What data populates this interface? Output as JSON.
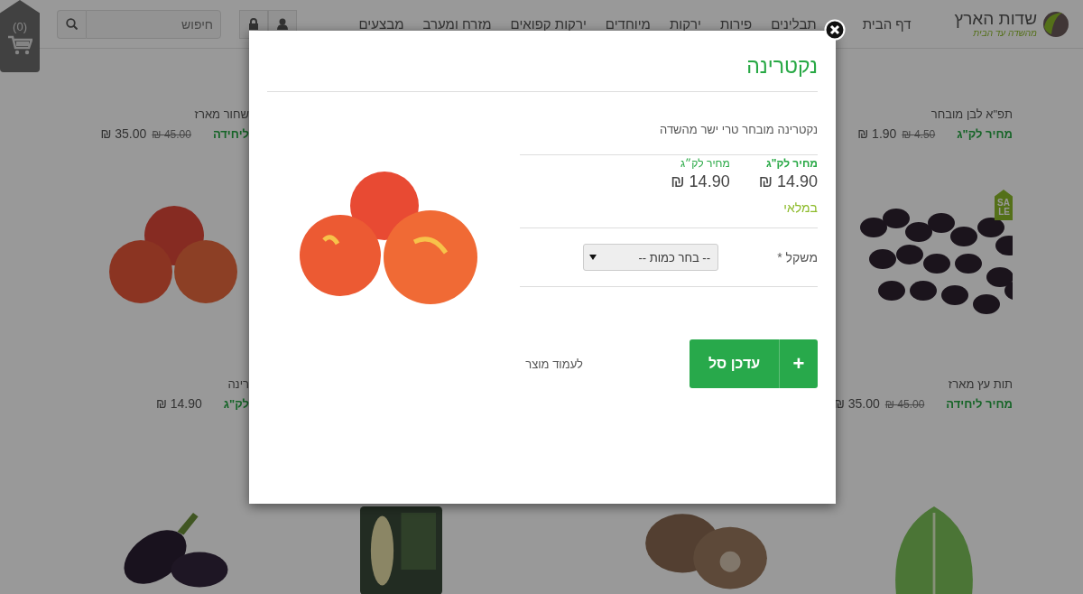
{
  "header": {
    "logo": {
      "name": "שדות הארץ",
      "tagline": "מהשדה עד הבית"
    },
    "nav": [
      "דף הבית",
      "תבלינים",
      "פירות",
      "ירקות",
      "מיוחדים",
      "ירקות קפואים",
      "מזרח ומערב",
      "מבצעים"
    ],
    "search": {
      "placeholder": "חיפוש"
    },
    "cart": {
      "count": "(0)"
    }
  },
  "products": [
    {
      "cards": [
        {
          "name": "תפ\"א לבן מובחר",
          "price_label": "מחיר לק\"ג",
          "old_price": "4.50 ₪",
          "price": "1.90 ₪"
        },
        {
          "name": "שחור מארז",
          "price_label": "ליחידה",
          "old_price": "45.00 ₪",
          "price": "35.00 ₪"
        }
      ]
    },
    {
      "cards": [
        {
          "kind": "berries",
          "badge": "SALE",
          "name": "תות עץ מארז",
          "price_label": "מחיר ליחידה",
          "old_price": "45.00 ₪",
          "price": "35.00 ₪"
        },
        {
          "kind": "fruit",
          "name": "רינה",
          "price_label": "לק\"ג",
          "price": "14.90 ₪"
        }
      ]
    },
    {
      "cards": [
        {
          "kind": "lettuce"
        },
        {
          "kind": "mushroom"
        },
        {
          "kind": "bag"
        },
        {
          "kind": "eggplant"
        }
      ]
    }
  ],
  "modal": {
    "title": "נקטרינה",
    "description": "נקטרינה מובחר טרי ישר מהשדה",
    "prices": [
      {
        "kind": "main",
        "label": "מחיר לק\"ג",
        "value": "14.90 ₪"
      },
      {
        "kind": "unit",
        "label": "מחיר לק״ג",
        "value": "14.90 ₪"
      }
    ],
    "stock": "במלאי",
    "weight": {
      "label": "משקל *",
      "value": "-- בחר כמות --"
    },
    "add_button": {
      "label": "עדכן סל",
      "icon": "+"
    },
    "product_link": "לעמוד מוצר"
  }
}
